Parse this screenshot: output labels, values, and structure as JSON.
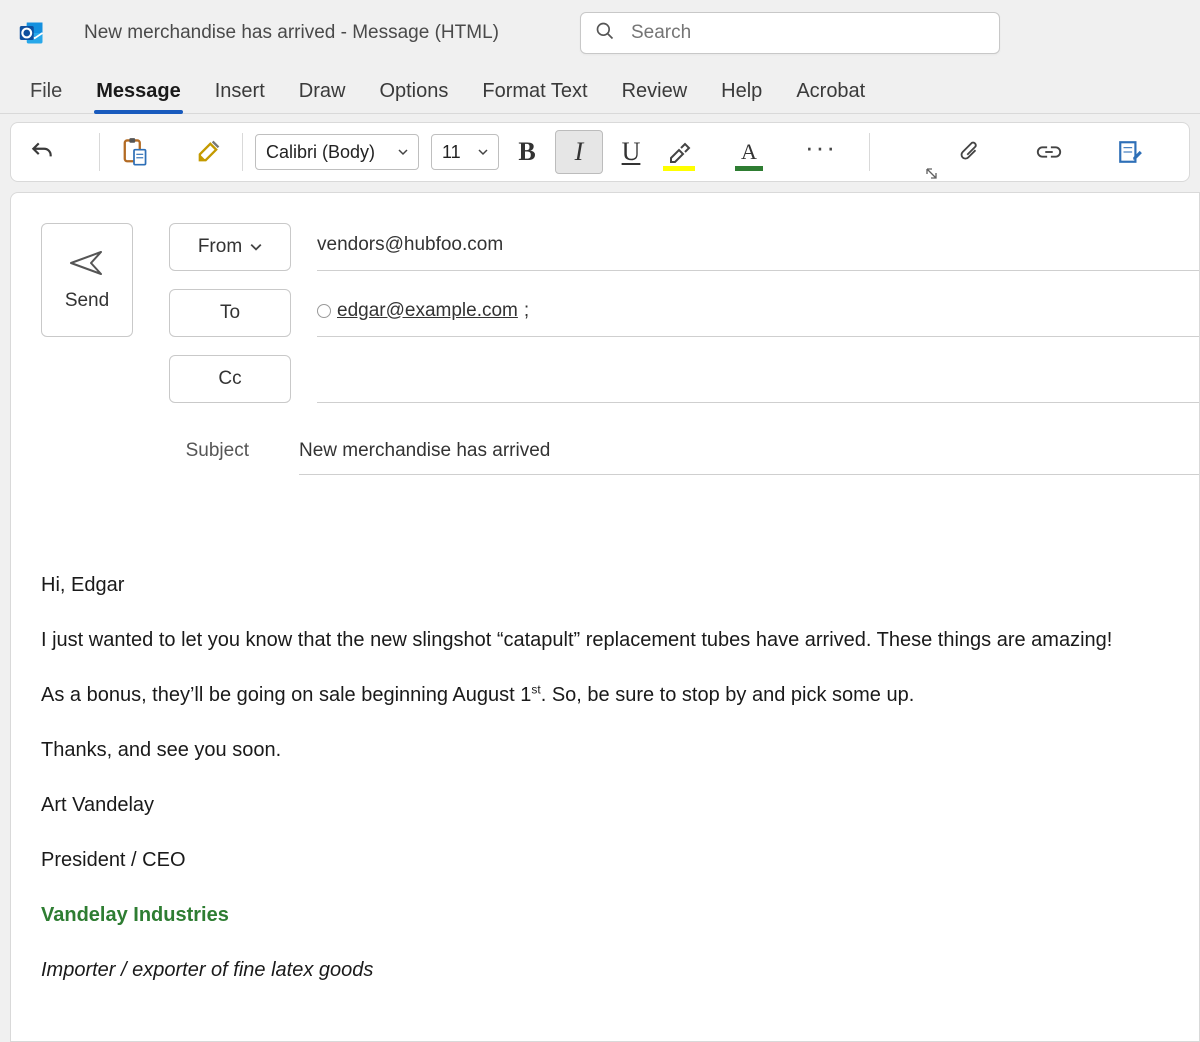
{
  "window": {
    "title": "New merchandise has arrived  -  Message (HTML)"
  },
  "search": {
    "placeholder": "Search"
  },
  "ribbonTabs": {
    "file": "File",
    "message": "Message",
    "insert": "Insert",
    "draw": "Draw",
    "options": "Options",
    "formatText": "Format Text",
    "review": "Review",
    "help": "Help",
    "acrobat": "Acrobat"
  },
  "toolbar": {
    "fontName": "Calibri (Body)",
    "fontSize": "11",
    "bold": "B",
    "italic": "I",
    "underline": "U",
    "highlightLetter": "",
    "fontColorLetter": "A",
    "highlightColor": "#ffff00",
    "fontColor": "#2e7d32",
    "more": "···"
  },
  "compose": {
    "sendLabel": "Send",
    "fromLabel": "From",
    "fromValue": "vendors@hubfoo.com",
    "toLabel": "To",
    "toRecipient": "edgar@example.com",
    "toSuffix": ";",
    "ccLabel": "Cc",
    "ccValue": "",
    "subjectLabel": "Subject",
    "subjectValue": "New merchandise has arrived"
  },
  "body": {
    "greeting": "Hi, Edgar",
    "p1": "I just wanted to let you know that the new slingshot “catapult” replacement tubes have arrived. These things are amazing!",
    "p2a": "As a bonus, they’ll be going on sale beginning August 1",
    "p2sup": "st",
    "p2b": ". So, be sure to stop by and pick some up.",
    "p3": "Thanks, and see you soon.",
    "sigName": "Art Vandelay",
    "sigTitle": "President / CEO",
    "sigCompany": "Vandelay Industries",
    "sigTag": "Importer / exporter of fine latex goods"
  }
}
